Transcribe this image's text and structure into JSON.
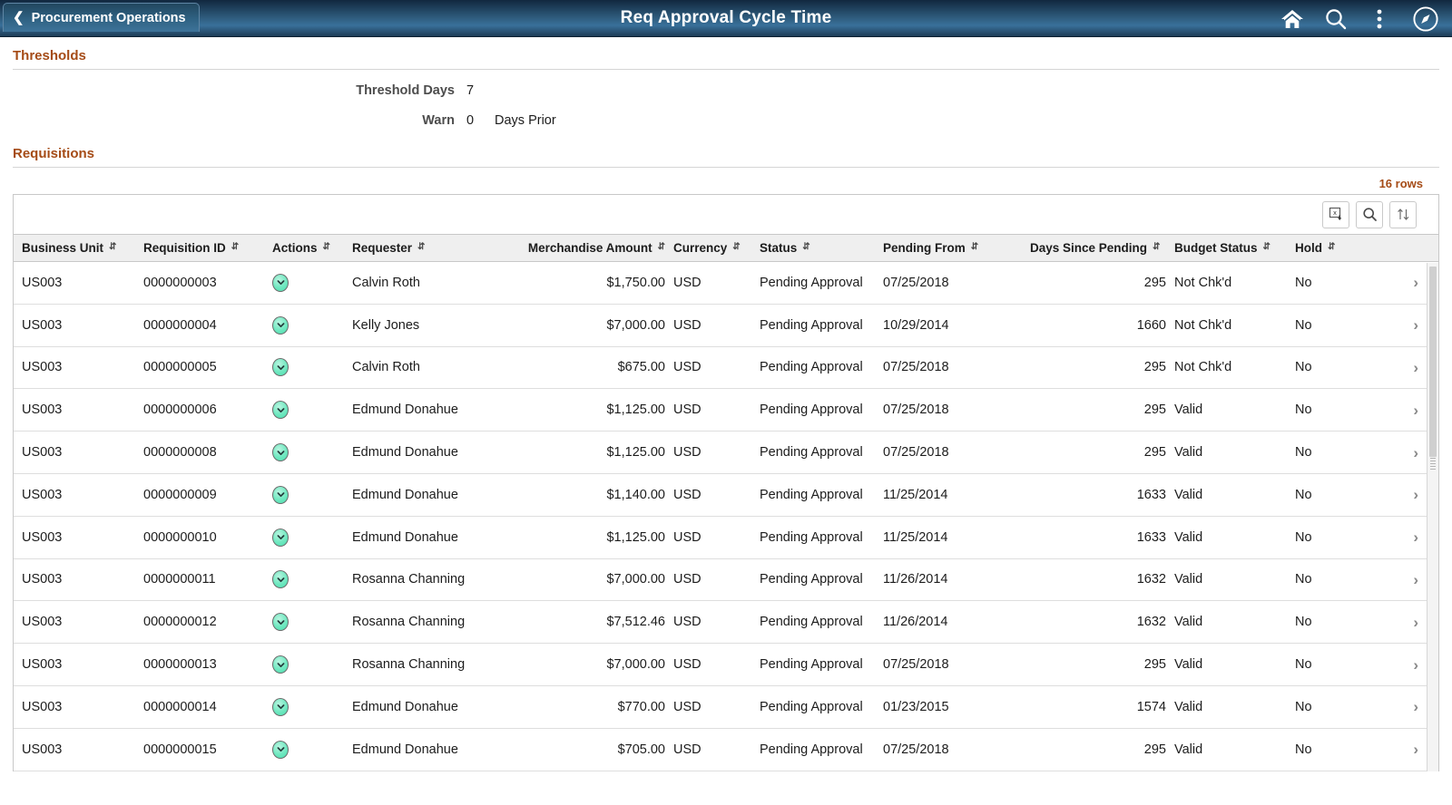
{
  "header": {
    "back_label": "Procurement Operations",
    "title": "Req Approval Cycle Time",
    "icons": {
      "home": "home-icon",
      "search": "search-icon",
      "actions": "actions-menu-icon",
      "navbar": "navbar-compass-icon"
    }
  },
  "thresholds": {
    "section_title": "Thresholds",
    "threshold_days_label": "Threshold Days",
    "threshold_days_value": "7",
    "warn_label": "Warn",
    "warn_value": "0",
    "warn_suffix": "Days Prior"
  },
  "requisitions": {
    "section_title": "Requisitions",
    "rows_count": "16 rows",
    "toolbar": {
      "export_excel": "download-excel-icon",
      "find": "search-icon",
      "sort": "sort-icon"
    },
    "columns": [
      "Business Unit",
      "Requisition ID",
      "Actions",
      "Requester",
      "Merchandise Amount",
      "Currency",
      "Status",
      "Pending From",
      "Days Since Pending",
      "Budget Status",
      "Hold"
    ],
    "rows": [
      {
        "business_unit": "US003",
        "req_id": "0000000003",
        "requester": "Calvin Roth",
        "amount": "$1,750.00",
        "currency": "USD",
        "status": "Pending Approval",
        "pending_from": "07/25/2018",
        "days_pending": "295",
        "budget_status": "Not Chk'd",
        "hold": "No"
      },
      {
        "business_unit": "US003",
        "req_id": "0000000004",
        "requester": "Kelly Jones",
        "amount": "$7,000.00",
        "currency": "USD",
        "status": "Pending Approval",
        "pending_from": "10/29/2014",
        "days_pending": "1660",
        "budget_status": "Not Chk'd",
        "hold": "No"
      },
      {
        "business_unit": "US003",
        "req_id": "0000000005",
        "requester": "Calvin Roth",
        "amount": "$675.00",
        "currency": "USD",
        "status": "Pending Approval",
        "pending_from": "07/25/2018",
        "days_pending": "295",
        "budget_status": "Not Chk'd",
        "hold": "No"
      },
      {
        "business_unit": "US003",
        "req_id": "0000000006",
        "requester": "Edmund Donahue",
        "amount": "$1,125.00",
        "currency": "USD",
        "status": "Pending Approval",
        "pending_from": "07/25/2018",
        "days_pending": "295",
        "budget_status": "Valid",
        "hold": "No"
      },
      {
        "business_unit": "US003",
        "req_id": "0000000008",
        "requester": "Edmund Donahue",
        "amount": "$1,125.00",
        "currency": "USD",
        "status": "Pending Approval",
        "pending_from": "07/25/2018",
        "days_pending": "295",
        "budget_status": "Valid",
        "hold": "No"
      },
      {
        "business_unit": "US003",
        "req_id": "0000000009",
        "requester": "Edmund Donahue",
        "amount": "$1,140.00",
        "currency": "USD",
        "status": "Pending Approval",
        "pending_from": "11/25/2014",
        "days_pending": "1633",
        "budget_status": "Valid",
        "hold": "No"
      },
      {
        "business_unit": "US003",
        "req_id": "0000000010",
        "requester": "Edmund Donahue",
        "amount": "$1,125.00",
        "currency": "USD",
        "status": "Pending Approval",
        "pending_from": "11/25/2014",
        "days_pending": "1633",
        "budget_status": "Valid",
        "hold": "No"
      },
      {
        "business_unit": "US003",
        "req_id": "0000000011",
        "requester": "Rosanna Channing",
        "amount": "$7,000.00",
        "currency": "USD",
        "status": "Pending Approval",
        "pending_from": "11/26/2014",
        "days_pending": "1632",
        "budget_status": "Valid",
        "hold": "No"
      },
      {
        "business_unit": "US003",
        "req_id": "0000000012",
        "requester": "Rosanna Channing",
        "amount": "$7,512.46",
        "currency": "USD",
        "status": "Pending Approval",
        "pending_from": "11/26/2014",
        "days_pending": "1632",
        "budget_status": "Valid",
        "hold": "No"
      },
      {
        "business_unit": "US003",
        "req_id": "0000000013",
        "requester": "Rosanna Channing",
        "amount": "$7,000.00",
        "currency": "USD",
        "status": "Pending Approval",
        "pending_from": "07/25/2018",
        "days_pending": "295",
        "budget_status": "Valid",
        "hold": "No"
      },
      {
        "business_unit": "US003",
        "req_id": "0000000014",
        "requester": "Edmund Donahue",
        "amount": "$770.00",
        "currency": "USD",
        "status": "Pending Approval",
        "pending_from": "01/23/2015",
        "days_pending": "1574",
        "budget_status": "Valid",
        "hold": "No"
      },
      {
        "business_unit": "US003",
        "req_id": "0000000015",
        "requester": "Edmund Donahue",
        "amount": "$705.00",
        "currency": "USD",
        "status": "Pending Approval",
        "pending_from": "07/25/2018",
        "days_pending": "295",
        "budget_status": "Valid",
        "hold": "No"
      }
    ]
  },
  "colors": {
    "header_dark": "#11283f",
    "header_mid": "#39709a",
    "section_title": "#a54b16",
    "action_icon_fill": "#6fe8c0"
  }
}
